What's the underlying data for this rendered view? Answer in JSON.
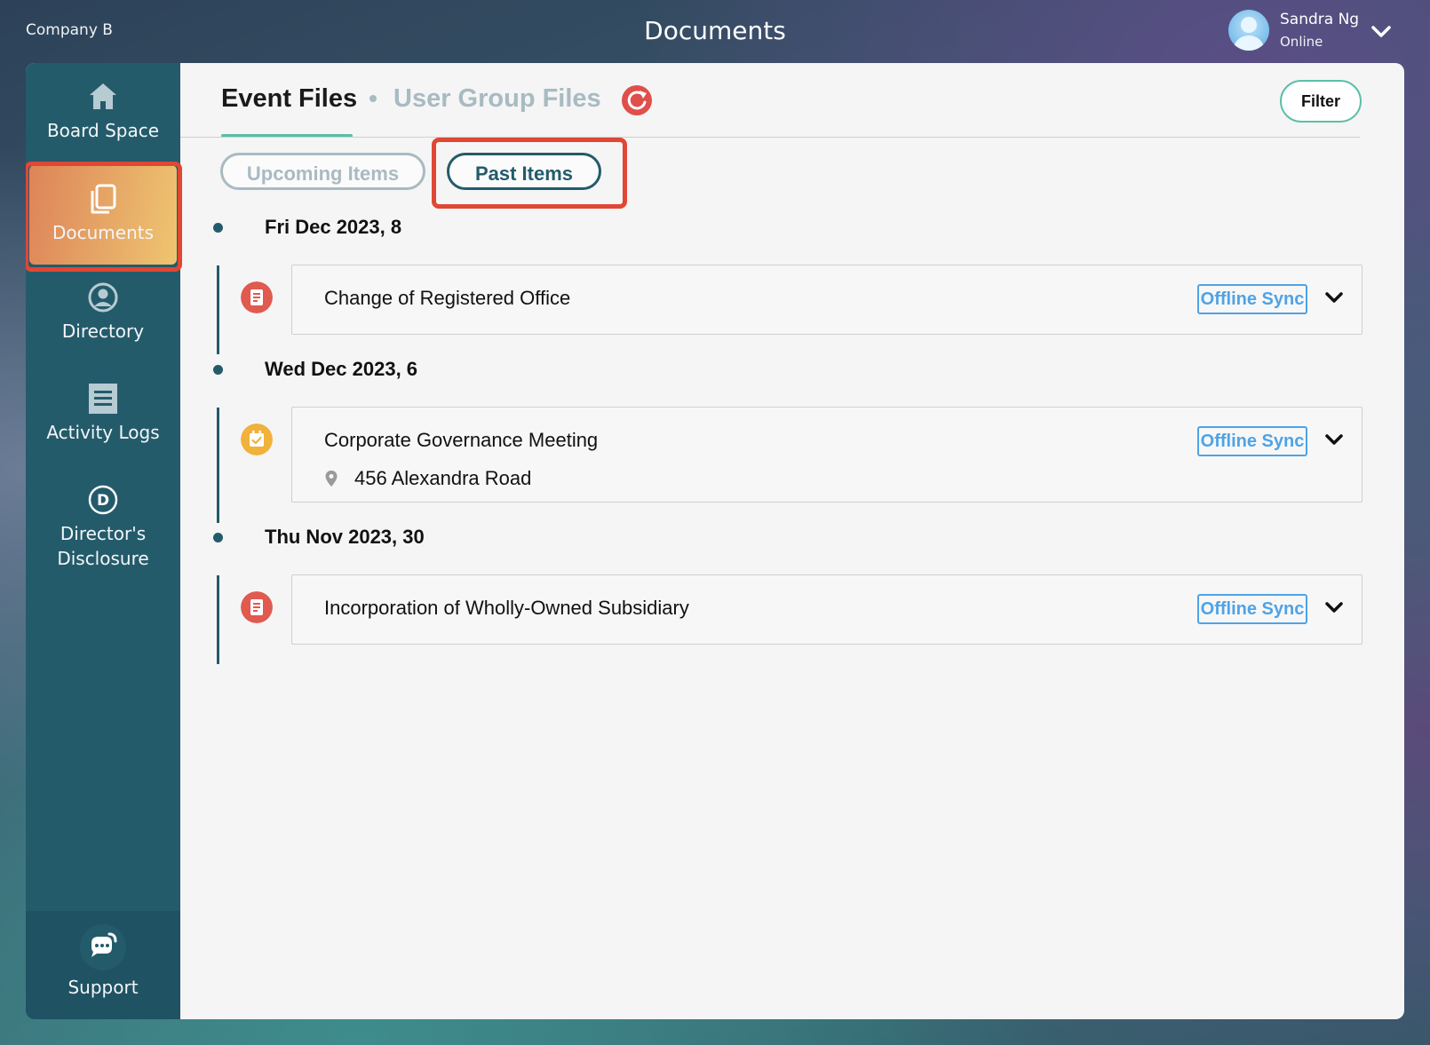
{
  "app": {
    "company": "Company B",
    "page_title": "Documents"
  },
  "user": {
    "name": "Sandra Ng",
    "status": "Online"
  },
  "sidebar": {
    "items": [
      {
        "label": "Board Space",
        "icon": "home-icon"
      },
      {
        "label": "Documents",
        "icon": "documents-icon",
        "active": true
      },
      {
        "label": "Directory",
        "icon": "user-circle-icon"
      },
      {
        "label": "Activity Logs",
        "icon": "list-icon"
      },
      {
        "label": "Director's",
        "label2": "Disclosure",
        "icon": "d-circle-icon"
      }
    ],
    "support_label": "Support"
  },
  "tabs": {
    "event_files": "Event Files",
    "user_group_files": "User Group Files"
  },
  "filter_label": "Filter",
  "pills": {
    "upcoming": "Upcoming Items",
    "past": "Past Items"
  },
  "groups": [
    {
      "date": "Fri Dec 2023, 8",
      "events": [
        {
          "title": "Change of Registered Office",
          "type": "document",
          "sync_label": "Offline Sync"
        }
      ]
    },
    {
      "date": "Wed Dec 2023, 6",
      "events": [
        {
          "title": "Corporate Governance Meeting",
          "location": "456 Alexandra Road",
          "type": "meeting",
          "sync_label": "Offline Sync"
        }
      ]
    },
    {
      "date": "Thu Nov 2023, 30",
      "events": [
        {
          "title": "Incorporation of Wholly-Owned Subsidiary",
          "type": "document",
          "sync_label": "Offline Sync"
        }
      ]
    }
  ],
  "colors": {
    "sidebar": "#245b6b",
    "accent_teal": "#5bbfa8",
    "highlight_red": "#e04735",
    "sync_blue": "#4fa3e6",
    "document_icon": "#e05a4f",
    "meeting_icon": "#f0b23a"
  }
}
